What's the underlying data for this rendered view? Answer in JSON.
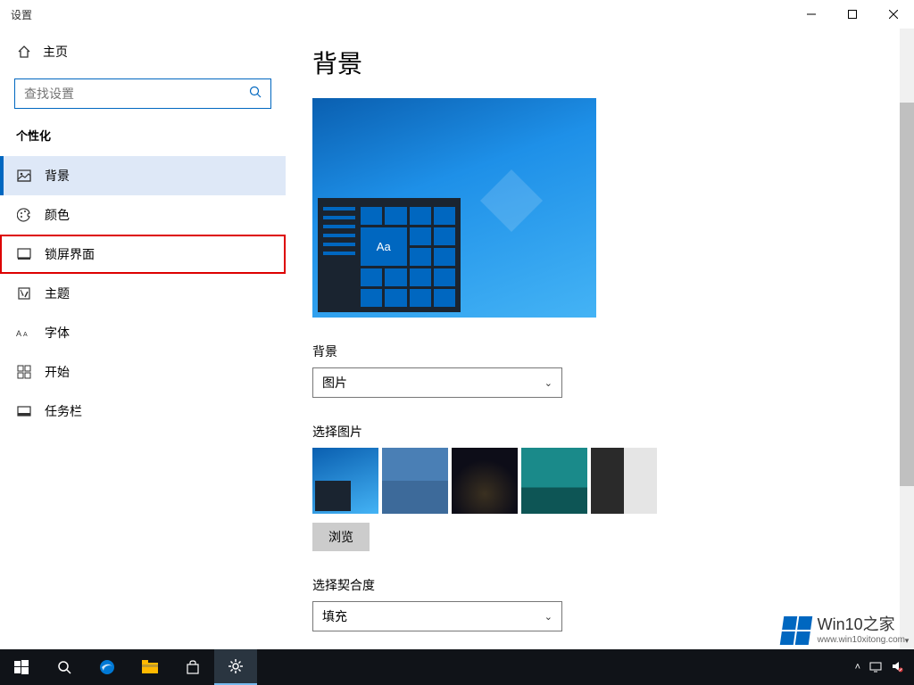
{
  "window": {
    "title": "设置"
  },
  "home_label": "主页",
  "search": {
    "placeholder": "查找设置"
  },
  "category": "个性化",
  "nav": [
    {
      "label": "背景",
      "icon": "picture-icon"
    },
    {
      "label": "颜色",
      "icon": "palette-icon"
    },
    {
      "label": "锁屏界面",
      "icon": "lockscreen-icon"
    },
    {
      "label": "主题",
      "icon": "theme-icon"
    },
    {
      "label": "字体",
      "icon": "font-icon"
    },
    {
      "label": "开始",
      "icon": "start-icon"
    },
    {
      "label": "任务栏",
      "icon": "taskbar-icon"
    }
  ],
  "nav_active_index": 0,
  "nav_highlighted_index": 2,
  "main": {
    "title": "背景",
    "preview_sample": "Aa",
    "background_label": "背景",
    "background_value": "图片",
    "choose_picture_label": "选择图片",
    "browse_label": "浏览",
    "fit_label": "选择契合度",
    "fit_value": "填充"
  },
  "watermark": {
    "brand": "Win10之家",
    "url": "www.win10xitong.com"
  }
}
